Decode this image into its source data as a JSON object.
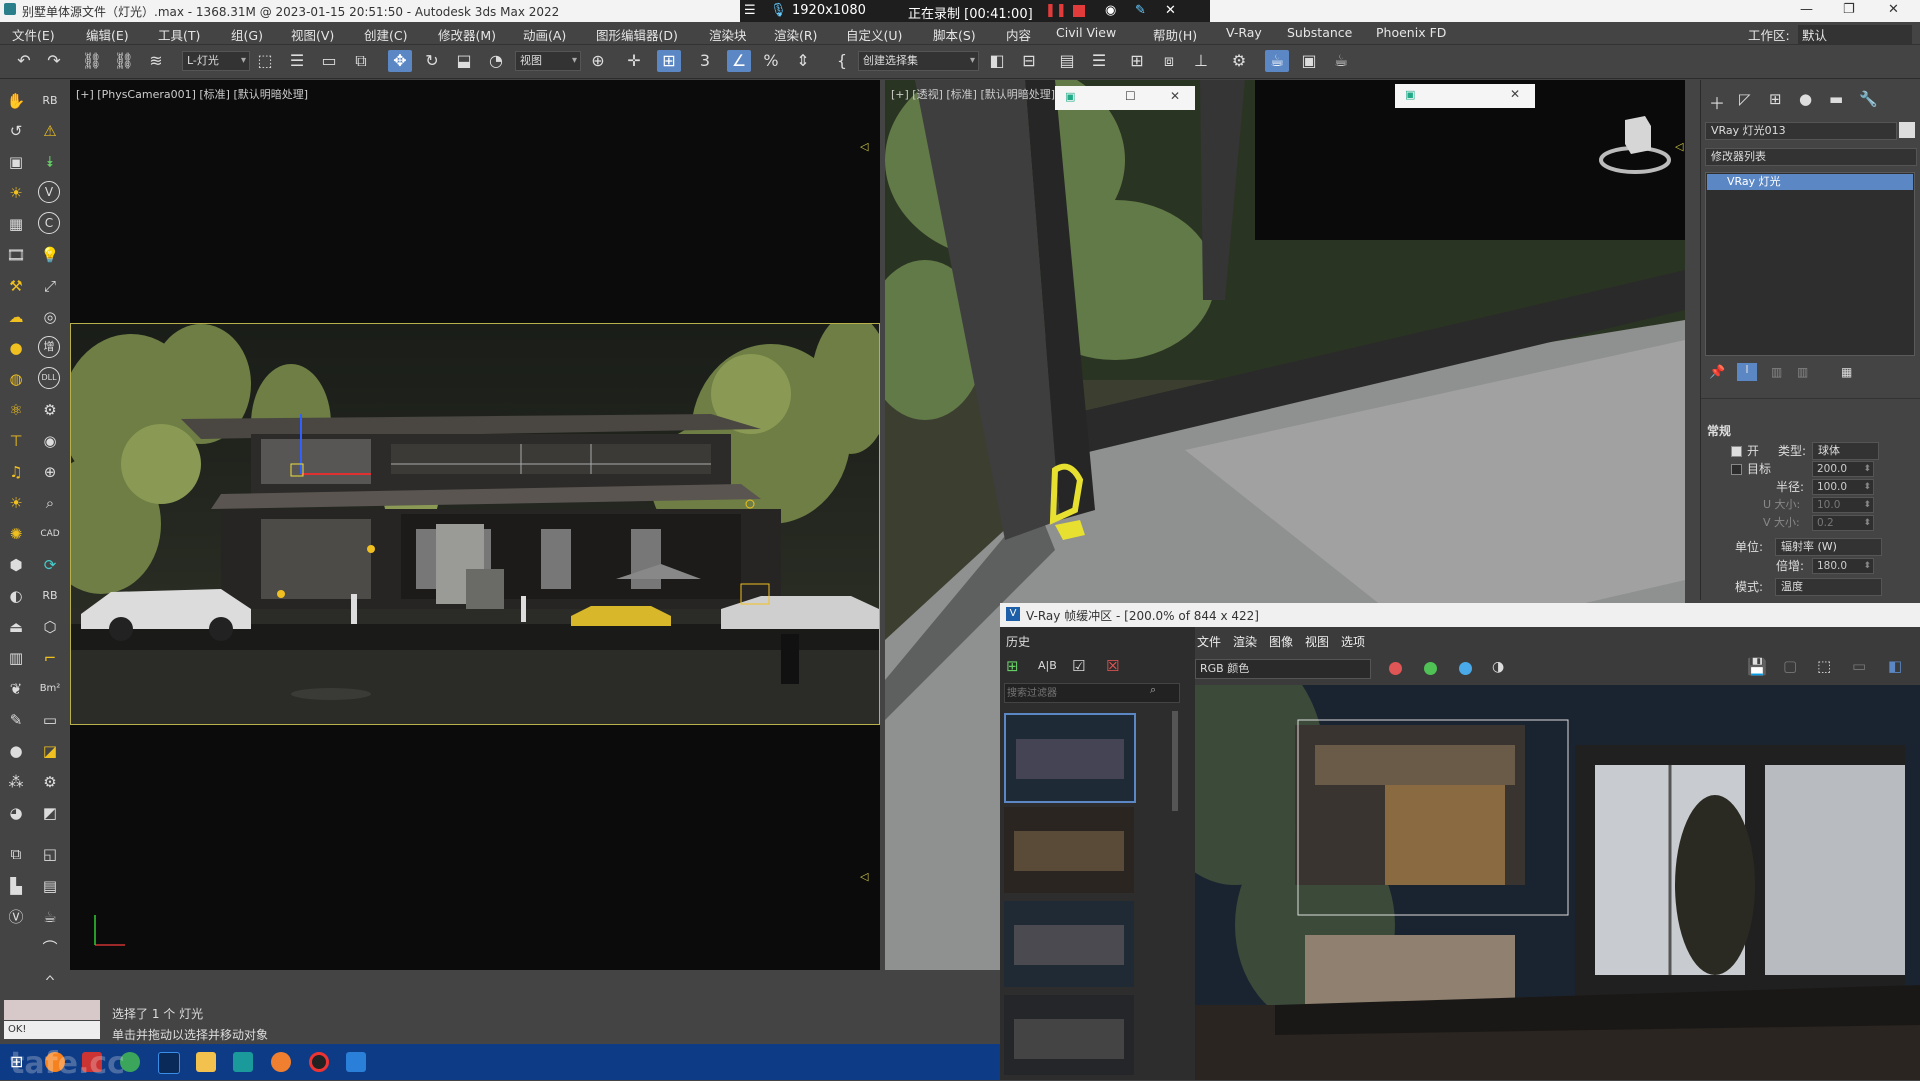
{
  "titlebar": {
    "title": "别墅单体源文件（灯光）.max - 1368.31M @ 2023-01-15 20:51:50 - Autodesk 3ds Max 2022",
    "recording_resolution": "1920x1080",
    "recording_status": "正在录制 [00:41:00]"
  },
  "menu": [
    "文件(E)",
    "编辑(E)",
    "工具(T)",
    "组(G)",
    "视图(V)",
    "创建(C)",
    "修改器(M)",
    "动画(A)",
    "图形编辑器(D)",
    "渲染块",
    "渲染(R)",
    "自定义(U)",
    "脚本(S)",
    "内容",
    "Civil View",
    "帮助(H)",
    "V-Ray",
    "Substance",
    "Phoenix FD"
  ],
  "workspace": {
    "label": "工作区:",
    "value": "默认"
  },
  "toolbar": {
    "layer_dropdown": "L-灯光",
    "ref_coord_dropdown": "视图",
    "selection_set_dropdown": "创建选择集"
  },
  "left_icon_text": {
    "rb": "RB",
    "v": "V",
    "c": "C",
    "dll": "DLL",
    "cad": "CAD",
    "bm": "Bm²",
    "tx": "增"
  },
  "viewport_left": {
    "label": "[+] [PhysCamera001] [标准] [默认明暗处理]"
  },
  "viewport_right": {
    "label": "[+] [透视] [标准] [默认明暗处理]"
  },
  "command_panel": {
    "object_name": "VRay 灯光013",
    "modifier_list": "修改器列表",
    "stack_item": "VRay 灯光",
    "rollout_title": "常规",
    "on_label": "开",
    "type_label": "类型:",
    "type_value": "球体",
    "target_label": "目标",
    "target_value": "200.0",
    "radius_label": "半径:",
    "radius_value": "100.0",
    "usize_label": "U 大小:",
    "usize_value": "10.0",
    "vsize_label": "V 大小:",
    "vsize_value": "0.2",
    "units_label": "单位:",
    "units_value": "辐射率 (W)",
    "multiplier_label": "倍增:",
    "multiplier_value": "180.0",
    "mode_label": "模式:",
    "mode_value": "温度"
  },
  "vfb": {
    "title": "V-Ray 帧缓冲区 - [200.0% of 844 x 422]",
    "history_label": "历史",
    "menu": [
      "文件",
      "渲染",
      "图像",
      "视图",
      "选项"
    ],
    "channel": "RGB 颜色",
    "search_placeholder": "搜索过滤器",
    "ab_label": "A|B"
  },
  "status": {
    "selection": "选择了 1 个 灯光",
    "prompt": "单击并拖动以选择并移动对象",
    "maxscript": "OK!"
  },
  "watermark": "tafe.cc",
  "colors": {
    "accent": "#5b87c5",
    "viewport_border": "#b8b04a",
    "taskbar": "#0e3b85",
    "record_red": "#e23b3b"
  }
}
